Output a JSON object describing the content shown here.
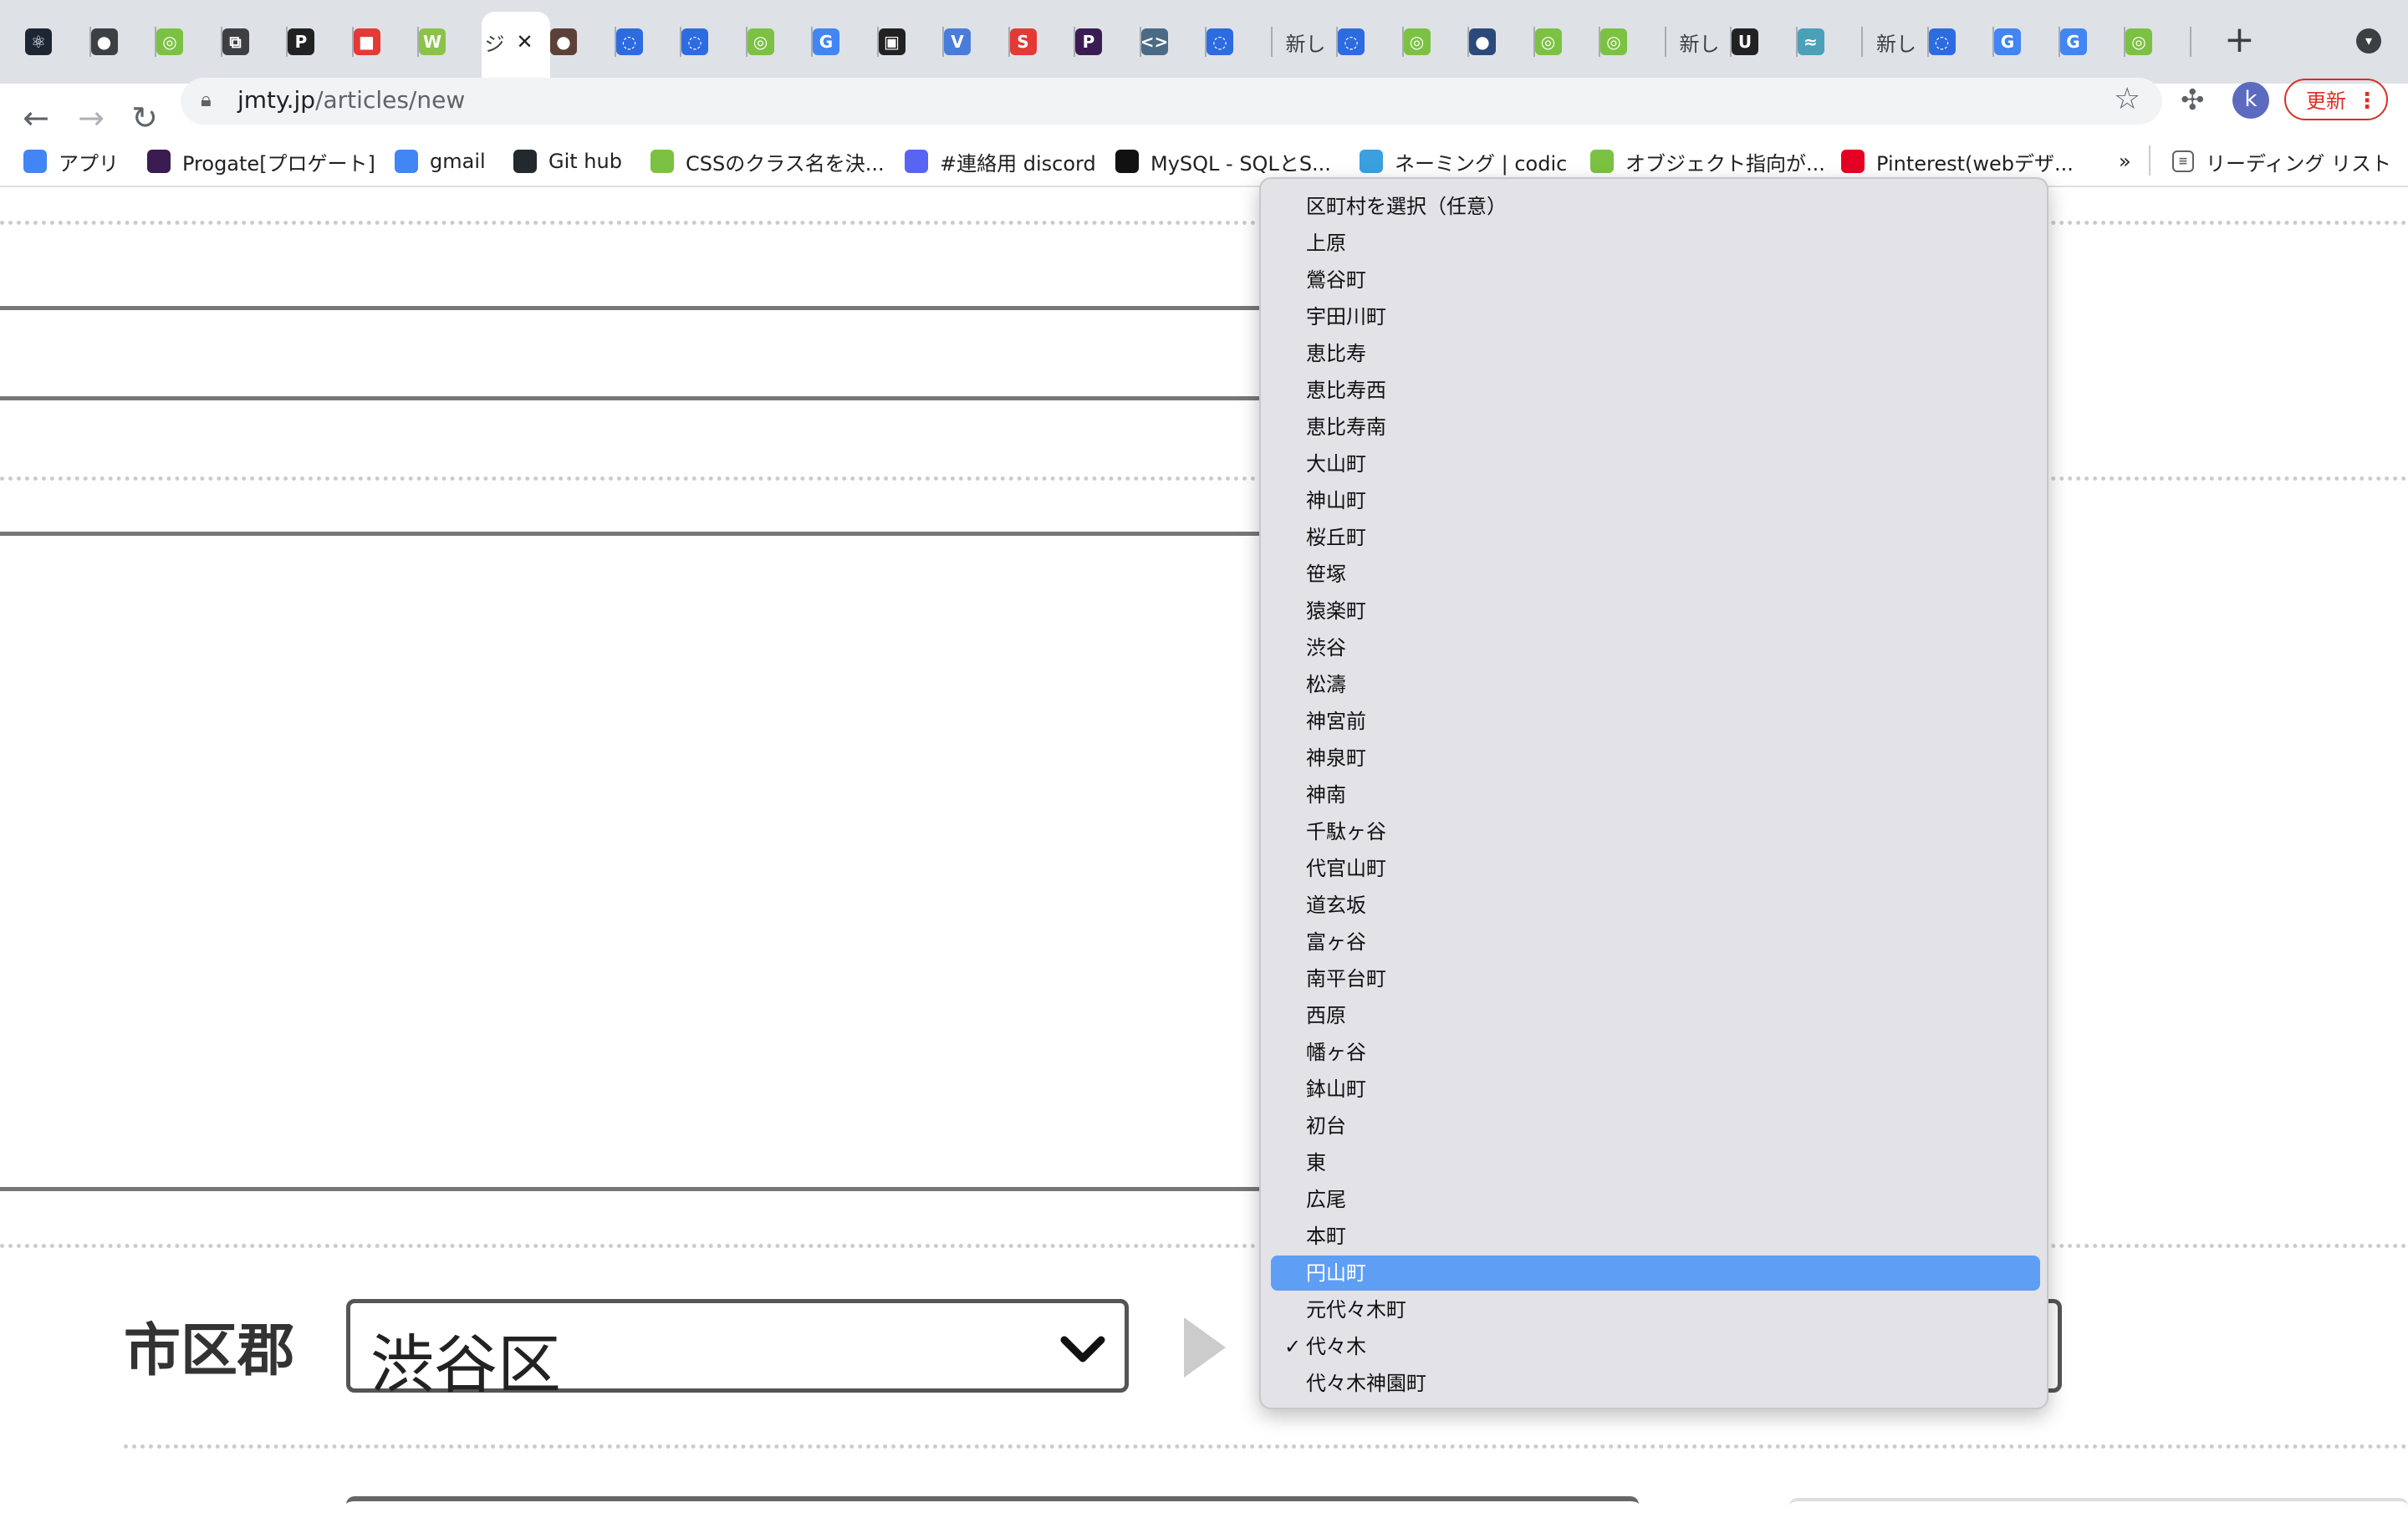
{
  "browser": {
    "tabs": [
      {
        "icon": "react-icon",
        "color": "#1d2733",
        "glyph": "⚛"
      },
      {
        "icon": "globe-icon",
        "color": "#3c4043",
        "glyph": "●"
      },
      {
        "icon": "green-circle-icon",
        "color": "#7cc242",
        "glyph": "◎"
      },
      {
        "icon": "external-window-icon",
        "color": "#3c4043",
        "glyph": "⧉"
      },
      {
        "icon": "p-icon",
        "color": "#222",
        "glyph": "P"
      },
      {
        "icon": "red-cube-icon",
        "color": "#e53935",
        "glyph": "■"
      },
      {
        "icon": "w-icon",
        "color": "#8bc34a",
        "glyph": "W"
      },
      {
        "icon": "jmty-icon",
        "color": "#ffffff",
        "glyph": ""
      },
      {
        "icon": "dark-bear-icon",
        "color": "#5d4037",
        "glyph": "●"
      },
      {
        "icon": "blue-chat-icon",
        "color": "#2d6be0",
        "glyph": "◌"
      },
      {
        "icon": "blue-chat-icon",
        "color": "#2d6be0",
        "glyph": "◌"
      },
      {
        "icon": "green-circle-icon",
        "color": "#7cc242",
        "glyph": "◎"
      },
      {
        "icon": "google-icon",
        "color": "#4285f4",
        "glyph": "G"
      },
      {
        "icon": "shopping-bag-icon",
        "color": "#222",
        "glyph": "▣"
      },
      {
        "icon": "v-icon",
        "color": "#4a7ddb",
        "glyph": "V"
      },
      {
        "icon": "red-s-icon",
        "color": "#e53935",
        "glyph": "S"
      },
      {
        "icon": "purple-p-icon",
        "color": "#3b1c52",
        "glyph": "P"
      },
      {
        "icon": "code-icon",
        "color": "#4a6a86",
        "glyph": "<>"
      },
      {
        "icon": "blue-chat-icon",
        "color": "#2d6be0",
        "glyph": "◌"
      },
      {
        "icon": "text-tab-icon",
        "color": "",
        "glyph": ""
      },
      {
        "icon": "blue-chat-icon",
        "color": "#2d6be0",
        "glyph": "◌"
      },
      {
        "icon": "green-circle-icon",
        "color": "#7cc242",
        "glyph": "◎"
      },
      {
        "icon": "earth-icon",
        "color": "#2a4a7a",
        "glyph": "●"
      },
      {
        "icon": "green-circle-icon",
        "color": "#7cc242",
        "glyph": "◎"
      },
      {
        "icon": "green-circle-icon",
        "color": "#7cc242",
        "glyph": "◎"
      },
      {
        "icon": "text-tab-icon",
        "color": "",
        "glyph": ""
      },
      {
        "icon": "u-icon",
        "color": "#222",
        "glyph": "U"
      },
      {
        "icon": "feather-icon",
        "color": "#4aa0b8",
        "glyph": "≈"
      },
      {
        "icon": "text-tab-icon",
        "color": "",
        "glyph": ""
      },
      {
        "icon": "blue-chat-icon",
        "color": "#2d6be0",
        "glyph": "◌"
      },
      {
        "icon": "google-icon",
        "color": "#4285f4",
        "glyph": "G"
      },
      {
        "icon": "google-icon",
        "color": "#4285f4",
        "glyph": "G"
      },
      {
        "icon": "green-circle-icon",
        "color": "#7cc242",
        "glyph": "◎"
      }
    ],
    "tab_texts": {
      "t19": "新し",
      "t25": "新し",
      "t28": "新し",
      "active_short": "ジ"
    },
    "url_host": "jmty.jp",
    "url_path": "/articles/new",
    "avatar_letter": "k",
    "update_label": "更新",
    "bookmarks": [
      {
        "label": "アプリ",
        "icon": "apps-grid-icon",
        "color": "#4285f4"
      },
      {
        "label": "Progate[プロゲート]",
        "icon": "progate-icon",
        "color": "#3b1c52"
      },
      {
        "label": "gmail",
        "icon": "google-icon",
        "color": "#4285f4"
      },
      {
        "label": "Git hub",
        "icon": "github-icon",
        "color": "#24292e"
      },
      {
        "label": "CSSのクラス名を決...",
        "icon": "green-circle-icon",
        "color": "#7cc242"
      },
      {
        "label": "#連絡用 discord",
        "icon": "discord-icon",
        "color": "#5865f2"
      },
      {
        "label": "MySQL - SQLとS...",
        "icon": "lambda-icon",
        "color": "#111111"
      },
      {
        "label": "ネーミング | codic",
        "icon": "codic-icon",
        "color": "#3aa0e0"
      },
      {
        "label": "オブジェクト指向が...",
        "icon": "green-circle-icon",
        "color": "#7cc242"
      },
      {
        "label": "Pinterest(webデザ...",
        "icon": "pinterest-icon",
        "color": "#e60023"
      }
    ],
    "bookmarks_overflow": "»",
    "reading_list": "リーディング リスト"
  },
  "form": {
    "city_label": "市区郡",
    "ward_value": "渋谷区"
  },
  "dropdown": {
    "options": [
      "区町村を選択（任意）",
      "上原",
      "鶯谷町",
      "宇田川町",
      "恵比寿",
      "恵比寿西",
      "恵比寿南",
      "大山町",
      "神山町",
      "桜丘町",
      "笹塚",
      "猿楽町",
      "渋谷",
      "松濤",
      "神宮前",
      "神泉町",
      "神南",
      "千駄ヶ谷",
      "代官山町",
      "道玄坂",
      "富ヶ谷",
      "南平台町",
      "西原",
      "幡ヶ谷",
      "鉢山町",
      "初台",
      "東",
      "広尾",
      "本町",
      "円山町",
      "元代々木町",
      "代々木",
      "代々木神園町"
    ],
    "highlighted": "円山町",
    "selected": "代々木",
    "highlight_color": "#5f9ef5"
  }
}
